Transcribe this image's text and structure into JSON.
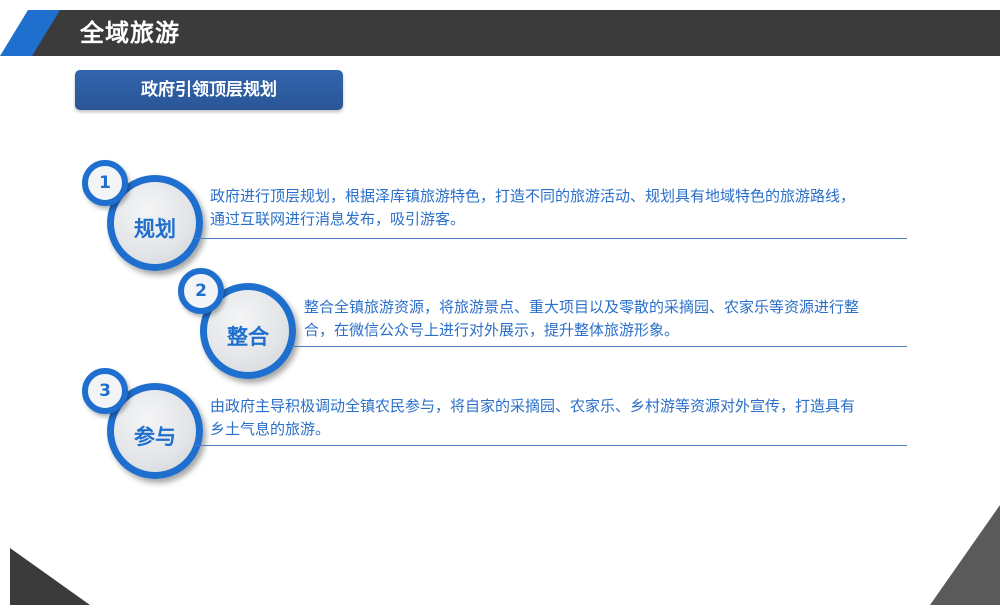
{
  "header": {
    "title": "全域旅游"
  },
  "section": {
    "subtitle": "政府引领顶层规划"
  },
  "items": [
    {
      "number": "1",
      "label": "规划",
      "text_line1": "政府进行顶层规划，根据泽库镇旅游特色，打造不同的旅游活动、规划具有地域特色的旅游路线，",
      "text_line2": "通过互联网进行消息发布，吸引游客。"
    },
    {
      "number": "2",
      "label": "整合",
      "text_line1": "整合全镇旅游资源，将旅游景点、重大项目以及零散的采摘园、农家乐等资源进行整",
      "text_line2": "合，在微信公众号上进行对外展示，提升整体旅游形象。"
    },
    {
      "number": "3",
      "label": "参与",
      "text_line1": "由政府主导积极调动全镇农民参与，将自家的采摘园、农家乐、乡村游等资源对外宣传，打造具有",
      "text_line2": "乡土气息的旅游。"
    }
  ],
  "colors": {
    "accent_blue": "#1f6fcf",
    "dark_bar": "#3b3b3b",
    "subtitle_bg": "#2d5ca2",
    "text_blue": "#2a6fc9"
  }
}
